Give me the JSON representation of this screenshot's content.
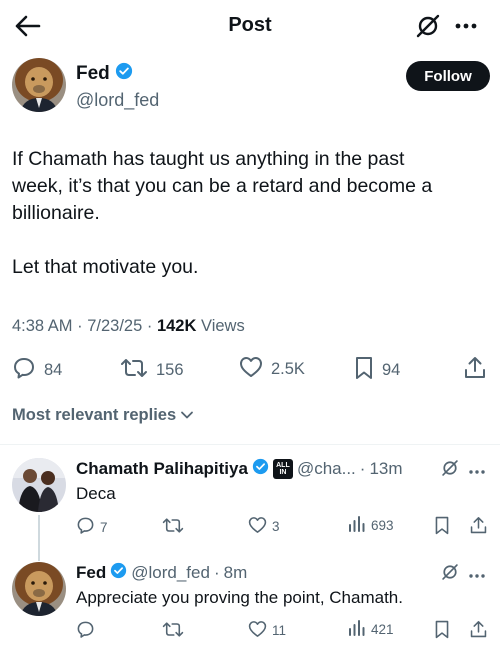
{
  "header": {
    "title": "Post"
  },
  "post": {
    "author": {
      "name": "Fed",
      "handle": "@lord_fed",
      "verified": true
    },
    "follow_label": "Follow",
    "text_paragraph_1_line_1": "If Chamath has taught us anything in the past",
    "text_paragraph_1_line_2": "week, it’s that you can be a retard and become a",
    "text_paragraph_1_line_3": "billionaire.",
    "text_paragraph_2": "Let that motivate you.",
    "meta": {
      "time": "4:38 AM",
      "sep1": " · ",
      "date": "7/23/25",
      "sep2": " · ",
      "views_count": "142K",
      "views_label": " Views"
    },
    "stats": {
      "replies": "84",
      "reposts": "156",
      "likes": "2.5K",
      "bookmarks": "94"
    }
  },
  "replies_sort": {
    "label": "Most relevant replies"
  },
  "replies": [
    {
      "name": "Chamath Palihapitiya",
      "badge_text_top": "ALL",
      "badge_text_bottom": "IN",
      "handle": "@cha...",
      "sep": " · ",
      "time": "13m",
      "text": "Deca",
      "stats": {
        "replies": "7",
        "reposts": "",
        "likes": "3",
        "views": "693"
      }
    },
    {
      "name": "Fed",
      "handle": "@lord_fed",
      "sep": " · ",
      "time": "8m",
      "text": "Appreciate you proving the point, Chamath.",
      "stats": {
        "replies": "",
        "reposts": "",
        "likes": "11",
        "views": "421"
      }
    }
  ],
  "colors": {
    "text": "#0f1419",
    "secondary": "#536471",
    "verified": "#1d9bf0",
    "divider": "#eff3f4"
  },
  "icons": [
    "back-arrow-icon",
    "grok-icon",
    "more-icon",
    "verified-icon",
    "reply-icon",
    "repost-icon",
    "like-icon",
    "bookmark-icon",
    "share-icon",
    "views-icon",
    "chevron-down-icon"
  ]
}
